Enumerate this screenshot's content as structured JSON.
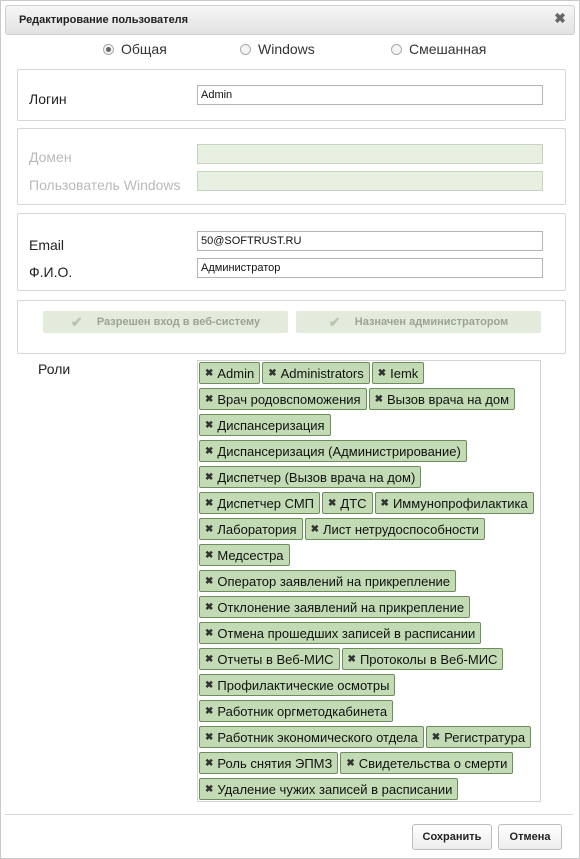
{
  "dialog": {
    "title": "Редактирование пользователя"
  },
  "auth": {
    "options": [
      {
        "label": "Общая",
        "selected": true
      },
      {
        "label": "Windows",
        "selected": false
      },
      {
        "label": "Смешанная",
        "selected": false
      }
    ]
  },
  "login": {
    "label": "Логин",
    "value": "Admin"
  },
  "windows": {
    "domain_label": "Домен",
    "domain_value": "",
    "user_label": "Пользователь Windows",
    "user_value": ""
  },
  "contact": {
    "email_label": "Email",
    "email_value": "50@SOFTRUST.RU",
    "fio_label": "Ф.И.О.",
    "fio_value": "Администратор"
  },
  "flags": {
    "web_access": "Разрешен вход в веб-систему",
    "admin": "Назначен администратором"
  },
  "roles": {
    "label": "Роли",
    "items": [
      "Admin",
      "Administrators",
      "Iemk",
      "Врач родовспоможения",
      "Вызов врача на дом",
      "Диспансеризация",
      "Диспансеризация (Администрирование)",
      "Диспетчер (Вызов врача на дом)",
      "Диспетчер СМП",
      "ДТС",
      "Иммунопрофилактика",
      "Лаборатория",
      "Лист нетрудоспособности",
      "Медсестра",
      "Оператор заявлений на прикрепление",
      "Отклонение заявлений на прикрепление",
      "Отмена прошедших записей в расписании",
      "Отчеты в Веб-МИС",
      "Протоколы в Веб-МИС",
      "Профилактические осмотры",
      "Работник оргметодкабинета",
      "Работник экономического отдела",
      "Регистратура",
      "Роль снятия ЭПМЗ",
      "Свидетельства о смерти",
      "Удаление чужих записей в расписании"
    ]
  },
  "buttons": {
    "save": "Сохранить",
    "cancel": "Отмена"
  }
}
